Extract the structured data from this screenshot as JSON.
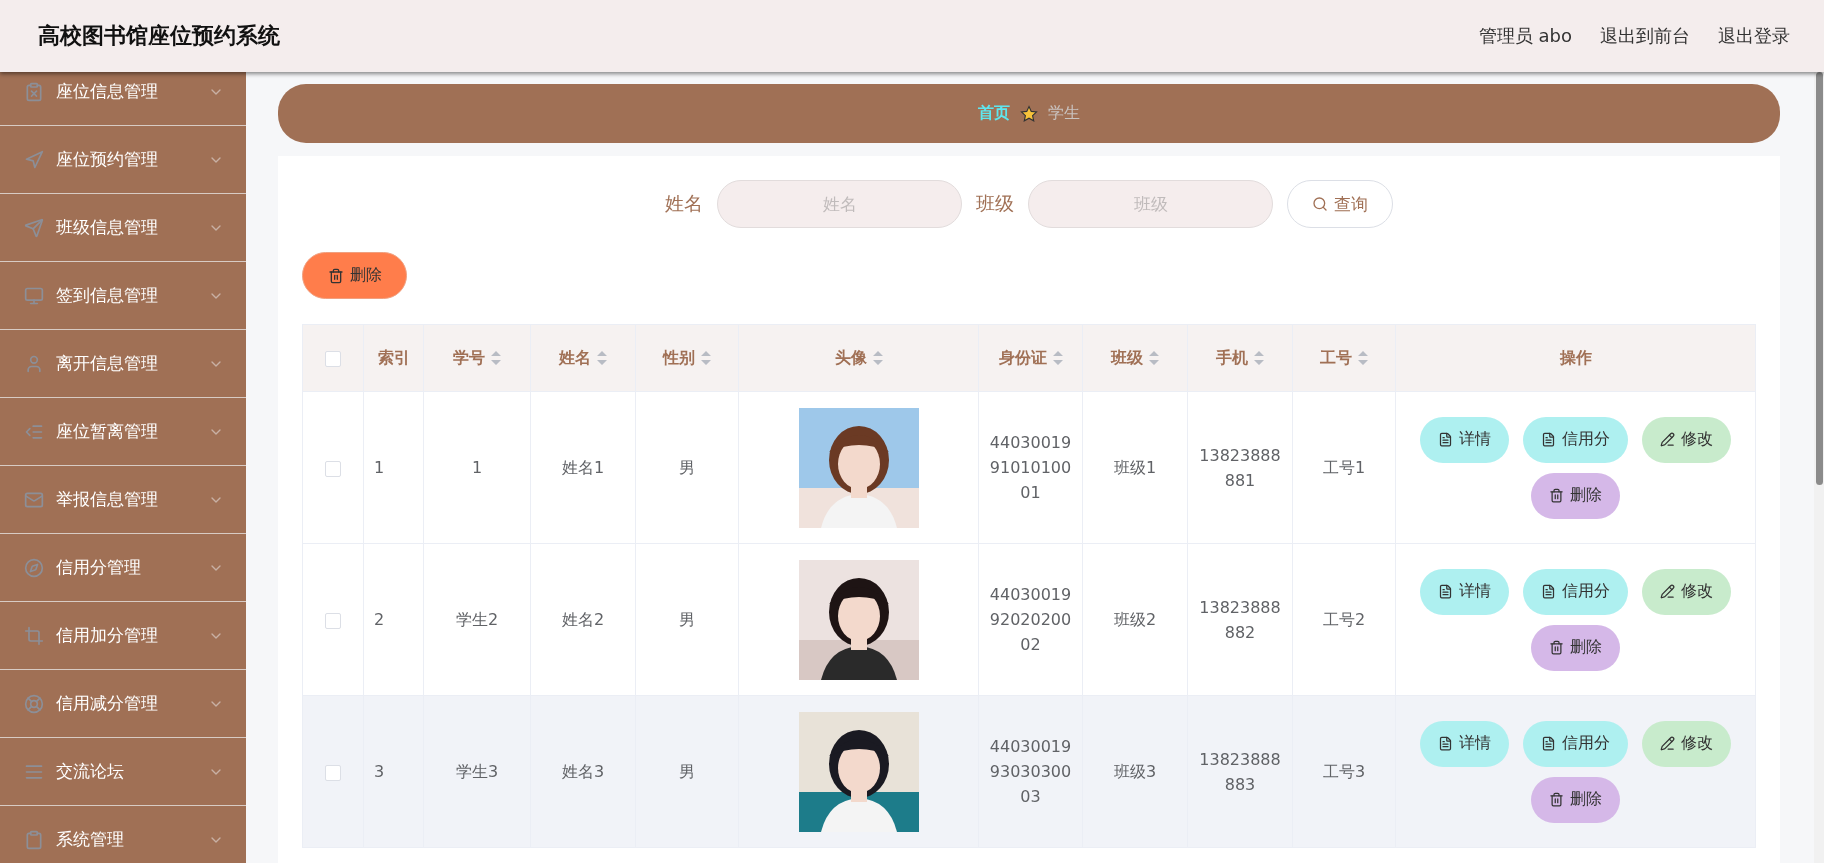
{
  "header": {
    "title": "高校图书馆座位预约系统",
    "links": [
      "管理员 abo",
      "退出到前台",
      "退出登录"
    ]
  },
  "sidebar": {
    "items": [
      {
        "label": "座位信息管理"
      },
      {
        "label": "座位预约管理"
      },
      {
        "label": "班级信息管理"
      },
      {
        "label": "签到信息管理"
      },
      {
        "label": "离开信息管理"
      },
      {
        "label": "座位暂离管理"
      },
      {
        "label": "举报信息管理"
      },
      {
        "label": "信用分管理"
      },
      {
        "label": "信用加分管理"
      },
      {
        "label": "信用减分管理"
      },
      {
        "label": "交流论坛"
      },
      {
        "label": "系统管理"
      }
    ]
  },
  "breadcrumb": {
    "home": "首页",
    "current": "学生"
  },
  "search": {
    "fields": [
      {
        "label": "姓名",
        "placeholder": "姓名"
      },
      {
        "label": "班级",
        "placeholder": "班级"
      }
    ],
    "button": "查询"
  },
  "toolbar": {
    "delete_button": "删除"
  },
  "table": {
    "select_all": {
      "checked": false
    },
    "columns": [
      {
        "label": "索引",
        "sortable": false
      },
      {
        "label": "学号",
        "sortable": true
      },
      {
        "label": "姓名",
        "sortable": true
      },
      {
        "label": "性别",
        "sortable": true
      },
      {
        "label": "头像",
        "sortable": true
      },
      {
        "label": "身份证",
        "sortable": true
      },
      {
        "label": "班级",
        "sortable": true
      },
      {
        "label": "手机",
        "sortable": true
      },
      {
        "label": "工号",
        "sortable": true
      },
      {
        "label": "操作",
        "sortable": false
      }
    ],
    "rows": [
      {
        "checked": false,
        "highlighted": false,
        "index": "1",
        "student_no": "1",
        "name": "姓名1",
        "gender": "男",
        "id_card": "440300199101010001",
        "class": "班级1",
        "phone": "13823888881",
        "work_no": "工号1",
        "actions": [
          {
            "kind": "detail",
            "label": "详情"
          },
          {
            "kind": "credit",
            "label": "信用分"
          },
          {
            "kind": "edit",
            "label": "修改"
          },
          {
            "kind": "delete",
            "label": "删除"
          }
        ]
      },
      {
        "checked": false,
        "highlighted": false,
        "index": "2",
        "student_no": "学生2",
        "name": "姓名2",
        "gender": "男",
        "id_card": "440300199202020002",
        "class": "班级2",
        "phone": "13823888882",
        "work_no": "工号2",
        "actions": [
          {
            "kind": "detail",
            "label": "详情"
          },
          {
            "kind": "credit",
            "label": "信用分"
          },
          {
            "kind": "edit",
            "label": "修改"
          },
          {
            "kind": "delete",
            "label": "删除"
          }
        ]
      },
      {
        "checked": false,
        "highlighted": true,
        "index": "3",
        "student_no": "学生3",
        "name": "姓名3",
        "gender": "男",
        "id_card": "440300199303030003",
        "class": "班级3",
        "phone": "13823888883",
        "work_no": "工号3",
        "actions": [
          {
            "kind": "detail",
            "label": "详情"
          },
          {
            "kind": "credit",
            "label": "信用分"
          },
          {
            "kind": "edit",
            "label": "修改"
          },
          {
            "kind": "delete",
            "label": "删除"
          }
        ]
      }
    ]
  }
}
